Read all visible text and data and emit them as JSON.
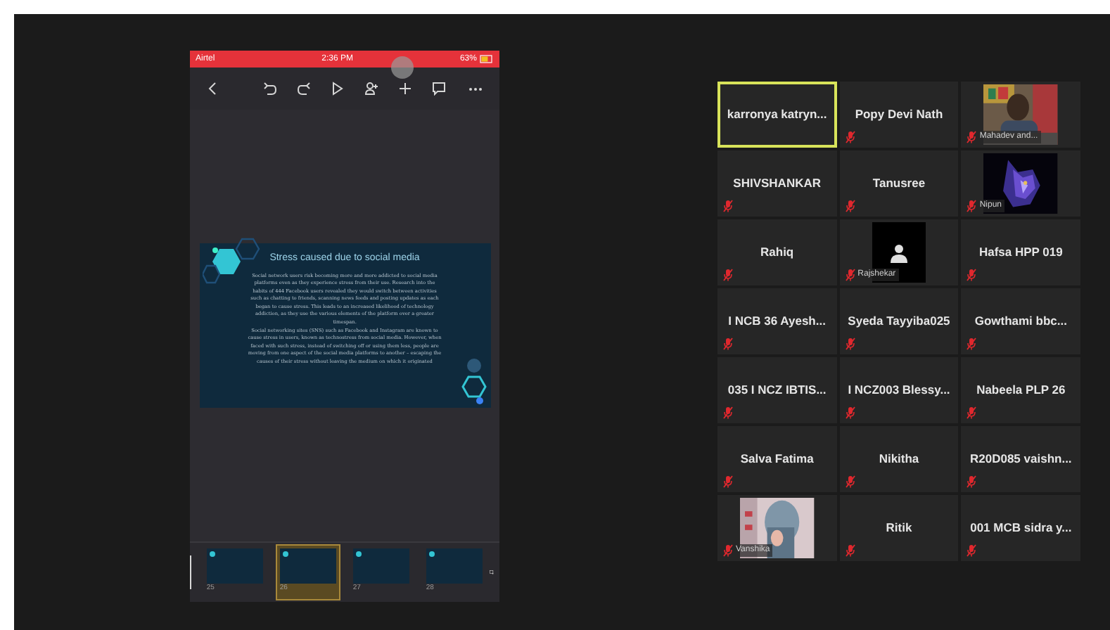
{
  "phone": {
    "status_bar": {
      "carrier": "Airtel",
      "time": "2:36 PM",
      "battery": "63%"
    },
    "slide": {
      "title": "Stress caused due to social media",
      "paragraphs": [
        "Social network users risk becoming more and more addicted to social media platforms even as they experience stress from their use. Research into the habits of 444 Facebook users revealed they would switch between activities such as chatting to friends, scanning news feeds and posting updates as each began to cause stress. This leads to an increased likelihood of technology addiction, as they use the various elements of the platform over a greater timespan.",
        "Social networking sites (SNS) such as Facebook and Instagram are known to cause stress in users, known as technostress from social media. However, when faced with such stress, instead of switching off or using them less, people are moving from one aspect of the social media platforms to another – escaping the causes of their stress without leaving the medium on which it originated"
      ]
    },
    "thumbnails": [
      {
        "number": "25",
        "selected": false
      },
      {
        "number": "26",
        "selected": true
      },
      {
        "number": "27",
        "selected": false
      },
      {
        "number": "28",
        "selected": false
      }
    ]
  },
  "participants": [
    {
      "kind": "name",
      "name": "karronya katryn...",
      "muted": false,
      "selected": true
    },
    {
      "kind": "name",
      "name": "Popy Devi Nath",
      "muted": true,
      "selected": false
    },
    {
      "kind": "video",
      "name": "Mahadev and...",
      "muted": true,
      "selected": false
    },
    {
      "kind": "name",
      "name": "SHIVSHANKAR",
      "muted": true,
      "selected": false
    },
    {
      "kind": "name",
      "name": "Tanusree",
      "muted": true,
      "selected": false
    },
    {
      "kind": "video",
      "name": "Nipun",
      "muted": true,
      "selected": false
    },
    {
      "kind": "name",
      "name": "Rahiq",
      "muted": true,
      "selected": false
    },
    {
      "kind": "avatar",
      "name": "Rajshekar",
      "muted": true,
      "selected": false
    },
    {
      "kind": "name",
      "name": "Hafsa HPP 019",
      "muted": true,
      "selected": false
    },
    {
      "kind": "name",
      "name": "I NCB 36 Ayesh...",
      "muted": true,
      "selected": false
    },
    {
      "kind": "name",
      "name": "Syeda Tayyiba025",
      "muted": true,
      "selected": false
    },
    {
      "kind": "name",
      "name": "Gowthami bbc...",
      "muted": true,
      "selected": false
    },
    {
      "kind": "name",
      "name": "035 I NCZ IBTIS...",
      "muted": true,
      "selected": false
    },
    {
      "kind": "name",
      "name": "I NCZ003 Blessy...",
      "muted": true,
      "selected": false
    },
    {
      "kind": "name",
      "name": "Nabeela PLP 26",
      "muted": true,
      "selected": false
    },
    {
      "kind": "name",
      "name": "Salva Fatima",
      "muted": true,
      "selected": false
    },
    {
      "kind": "name",
      "name": "Nikitha",
      "muted": true,
      "selected": false
    },
    {
      "kind": "name",
      "name": "R20D085 vaishn...",
      "muted": true,
      "selected": false
    },
    {
      "kind": "video",
      "name": "Vanshika",
      "muted": true,
      "selected": false
    },
    {
      "kind": "name",
      "name": "Ritik",
      "muted": true,
      "selected": false
    },
    {
      "kind": "name",
      "name": "001 MCB sidra y...",
      "muted": true,
      "selected": false
    }
  ]
}
